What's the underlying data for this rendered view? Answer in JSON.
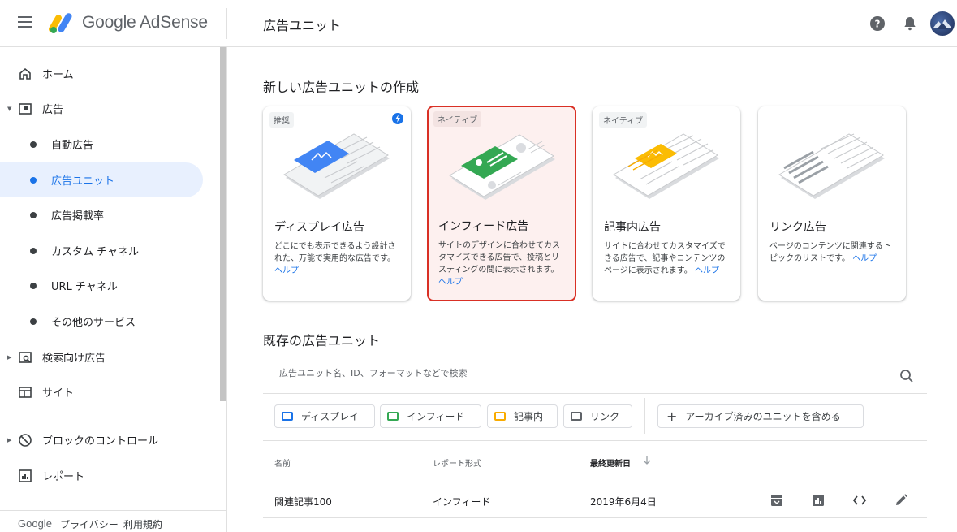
{
  "header": {
    "app_name": "Google AdSense",
    "page_title": "広告ユニット"
  },
  "sidebar": {
    "items": [
      {
        "label": "ホーム"
      },
      {
        "label": "広告"
      },
      {
        "label": "自動広告"
      },
      {
        "label": "広告ユニット"
      },
      {
        "label": "広告掲載率"
      },
      {
        "label": "カスタム チャネル"
      },
      {
        "label": "URL チャネル"
      },
      {
        "label": "その他のサービス"
      },
      {
        "label": "検索向け広告"
      },
      {
        "label": "サイト"
      },
      {
        "label": "ブロックのコントロール"
      },
      {
        "label": "レポート"
      }
    ],
    "footer": {
      "google": "Google",
      "privacy": "プライバシー",
      "terms": "利用規約"
    }
  },
  "create_section": {
    "title": "新しい広告ユニットの作成",
    "cards": [
      {
        "badge": "推奨",
        "title": "ディスプレイ広告",
        "desc": "どこにでも表示できるよう設計された、万能で実用的な広告です。",
        "help": "ヘルプ"
      },
      {
        "badge": "ネイティブ",
        "title": "インフィード広告",
        "desc": "サイトのデザインに合わせてカスタマイズできる広告で、投稿とリスティングの間に表示されます。",
        "help": "ヘルプ"
      },
      {
        "badge": "ネイティブ",
        "title": "記事内広告",
        "desc": "サイトに合わせてカスタマイズできる広告で、記事やコンテンツのページに表示されます。",
        "help": "ヘルプ"
      },
      {
        "badge": "",
        "title": "リンク広告",
        "desc": "ページのコンテンツに関連するトピックのリストです。",
        "help": "ヘルプ"
      }
    ]
  },
  "existing_section": {
    "title": "既存の広告ユニット",
    "search_placeholder": "広告ユニット名、ID、フォーマットなどで検索",
    "filters": [
      {
        "label": "ディスプレイ",
        "color": "#1a73e8"
      },
      {
        "label": "インフィード",
        "color": "#34a853"
      },
      {
        "label": "記事内",
        "color": "#f9ab00"
      },
      {
        "label": "リンク",
        "color": "#5f6368"
      }
    ],
    "archive_chip": "アーカイブ済みのユニットを含める",
    "columns": {
      "name": "名前",
      "format": "レポート形式",
      "updated": "最終更新日"
    },
    "rows": [
      {
        "name": "関連記事100",
        "format": "インフィード",
        "updated": "2019年6月4日"
      }
    ]
  },
  "colors": {
    "accent": "#1a73e8",
    "selected_border": "#d93025"
  }
}
